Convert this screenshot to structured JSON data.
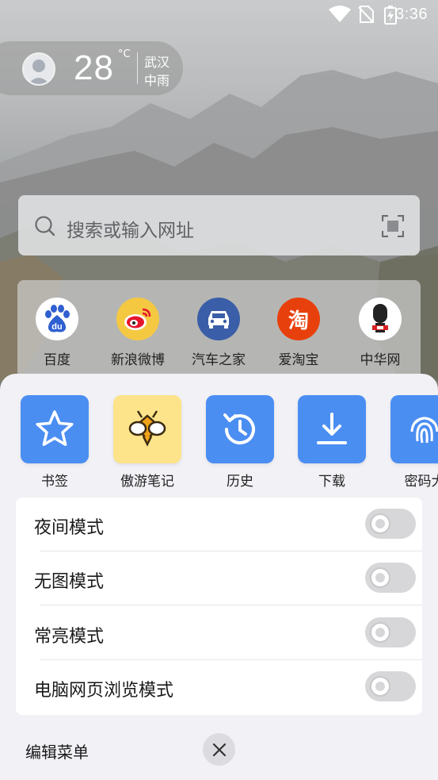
{
  "status_bar": {
    "time": "3:36"
  },
  "weather": {
    "temperature": "28",
    "unit": "°C",
    "city": "武汉",
    "condition": "中雨"
  },
  "search": {
    "placeholder": "搜索或输入网址"
  },
  "quick_sites": [
    {
      "label": "百度",
      "icon": "baidu-icon",
      "color": "#ffffff"
    },
    {
      "label": "新浪微博",
      "icon": "weibo-icon",
      "color": "#f5c842"
    },
    {
      "label": "汽车之家",
      "icon": "car-icon",
      "color": "#3a5ea8"
    },
    {
      "label": "爱淘宝",
      "icon": "taobao-icon",
      "color": "#e8400c"
    },
    {
      "label": "中华网",
      "icon": "china-com-icon",
      "color": "#ffffff"
    }
  ],
  "tools": [
    {
      "label": "书签",
      "icon": "star-icon"
    },
    {
      "label": "傲游笔记",
      "icon": "bee-icon"
    },
    {
      "label": "历史",
      "icon": "history-icon"
    },
    {
      "label": "下载",
      "icon": "download-icon"
    },
    {
      "label": "密码大",
      "icon": "fingerprint-icon"
    }
  ],
  "settings": [
    {
      "label": "夜间模式",
      "enabled": false
    },
    {
      "label": "无图模式",
      "enabled": false
    },
    {
      "label": "常亮模式",
      "enabled": false
    },
    {
      "label": "电脑网页浏览模式",
      "enabled": false
    }
  ],
  "bottom": {
    "edit_menu": "编辑菜单"
  },
  "colors": {
    "accent_blue": "#4b8ef2",
    "note_yellow": "#fde38a",
    "sheet_bg": "#f1f1f6",
    "toggle_off": "#d7d7d9"
  }
}
